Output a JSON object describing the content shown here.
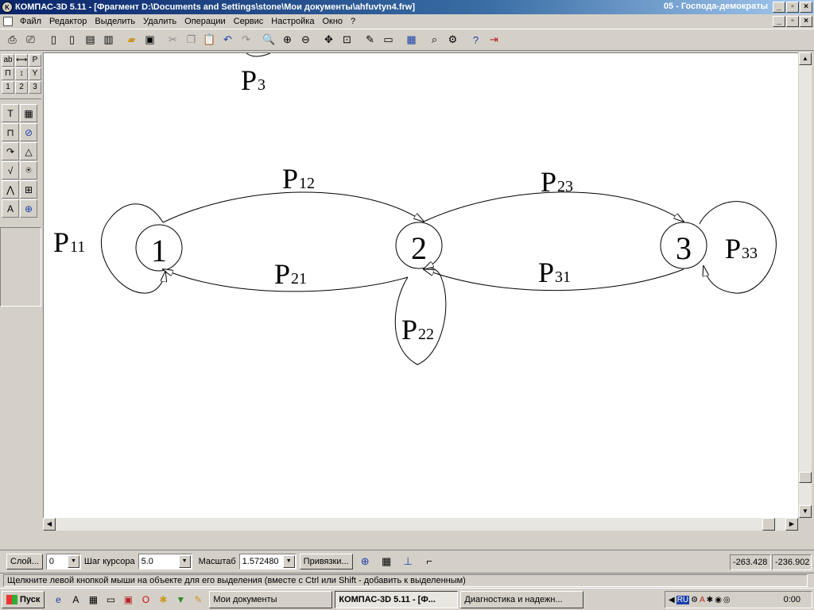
{
  "window": {
    "title": "КОМПАС-3D 5.11 - [Фрагмент D:\\Documents and Settings\\stone\\Мои документы\\ahfuvtyn4.frw]",
    "right_text": "05 - Господа-демократы",
    "minimize_glyph": "_",
    "maximize_glyph": "▫",
    "close_glyph": "×"
  },
  "menu": [
    "Файл",
    "Редактор",
    "Выделить",
    "Удалить",
    "Операции",
    "Сервис",
    "Настройка",
    "Окно",
    "?"
  ],
  "toolbar_icons": [
    "preview-icon",
    "print-icon",
    "new-icon",
    "new-doc-icon",
    "new-text-icon",
    "new-spec-icon",
    "open-icon",
    "save-icon",
    "cut-icon",
    "copy-icon",
    "paste-icon",
    "undo-icon",
    "redo-icon",
    "zoom-icon",
    "zoom-in-icon",
    "zoom-out-icon",
    "pan-icon",
    "fit-icon",
    "edit-icon",
    "panel-icon",
    "calc-icon",
    "measure-icon",
    "lib-icon",
    "help-icon",
    "exit-icon"
  ],
  "left_panel": {
    "grid": [
      "ab",
      "⟷",
      "P",
      "П",
      "↕",
      "Y",
      "1",
      "2",
      "3"
    ],
    "tools": [
      "T",
      "▦",
      "⊓",
      "⊘",
      "↷",
      "△",
      "√",
      "⍟",
      "⋀",
      "⊞",
      "A",
      "⊕"
    ]
  },
  "drawing": {
    "nodes": [
      {
        "label": "1"
      },
      {
        "label": "2"
      },
      {
        "label": "3"
      }
    ],
    "edge_labels": [
      {
        "main": "P",
        "sub": "3"
      },
      {
        "main": "P",
        "sub": "12"
      },
      {
        "main": "P",
        "sub": "23"
      },
      {
        "main": "P",
        "sub": "11"
      },
      {
        "main": "P",
        "sub": "21"
      },
      {
        "main": "P",
        "sub": "31"
      },
      {
        "main": "P",
        "sub": "33"
      },
      {
        "main": "P",
        "sub": "22"
      }
    ]
  },
  "params": {
    "layer_button": "Слой...",
    "layer_value": "0",
    "step_label": "Шаг курсора",
    "step_value": "5.0",
    "scale_label": "Масштаб",
    "scale_value": "1.572480",
    "snap_button": "Привязки...",
    "coord_x": "-263.428",
    "coord_y": "-236.902"
  },
  "status": "Щелкните левой кнопкой мыши на объекте для его выделения (вместе с Ctrl или Shift - добавить к выделенным)",
  "taskbar": {
    "start": "Пуск",
    "items": [
      "Мои документы",
      "КОМПАС-3D 5.11 - [Ф...",
      "Диагностика и надежн..."
    ],
    "lang": "RU",
    "clock": "0:00"
  }
}
